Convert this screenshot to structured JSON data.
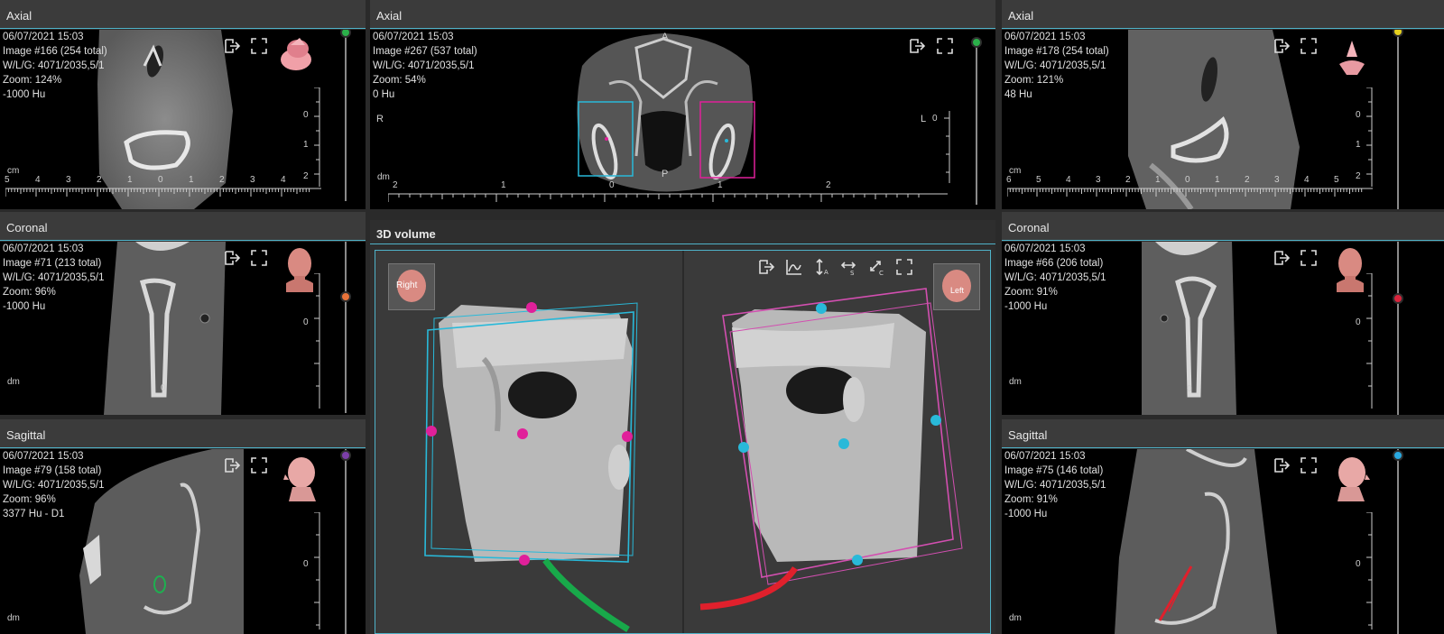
{
  "panels": {
    "axial_left": {
      "title": "Axial",
      "date": "06/07/2021 15:03",
      "image": "Image #166 (254 total)",
      "wl": "W/L/G: 4071/2035,5/1",
      "zoom": "Zoom: 124%",
      "hu": "-1000 Hu",
      "unit": "cm",
      "ticks": [
        "5",
        "4",
        "3",
        "2",
        "1",
        "0",
        "1",
        "2",
        "3",
        "4"
      ],
      "vticks": [
        "0",
        "1",
        "2"
      ],
      "knob_color": "#2bb04a"
    },
    "axial_center": {
      "title": "Axial",
      "date": "06/07/2021 15:03",
      "image": "Image #267 (537 total)",
      "wl": "W/L/G: 4071/2035,5/1",
      "zoom": "Zoom: 54%",
      "hu": "0 Hu",
      "unit": "dm",
      "ticks": [
        "2",
        "1",
        "0",
        "1",
        "2"
      ],
      "label_r": "R",
      "label_l": "L",
      "label_a": "A",
      "label_p": "P",
      "vticks": [
        "0"
      ],
      "knob_color": "#2bb04a"
    },
    "axial_right": {
      "title": "Axial",
      "date": "06/07/2021 15:03",
      "image": "Image #178 (254 total)",
      "wl": "W/L/G: 4071/2035,5/1",
      "zoom": "Zoom: 121%",
      "hu": "48 Hu",
      "unit": "cm",
      "ticks": [
        "6",
        "5",
        "4",
        "3",
        "2",
        "1",
        "0",
        "1",
        "2",
        "3",
        "4",
        "5"
      ],
      "vticks": [
        "0",
        "1",
        "2"
      ],
      "knob_color": "#e6d21e"
    },
    "coronal_left": {
      "title": "Coronal",
      "date": "06/07/2021 15:03",
      "image": "Image #71 (213 total)",
      "wl": "W/L/G: 4071/2035,5/1",
      "zoom": "Zoom: 96%",
      "hu": "-1000 Hu",
      "unit": "dm",
      "vticks": [
        "0",
        "0"
      ],
      "knob_color": "#e8733a"
    },
    "coronal_right": {
      "title": "Coronal",
      "date": "06/07/2021 15:03",
      "image": "Image #66 (206 total)",
      "wl": "W/L/G: 4071/2035,5/1",
      "zoom": "Zoom: 91%",
      "hu": "-1000 Hu",
      "unit": "dm",
      "vticks": [
        "0",
        "0"
      ],
      "knob_color": "#d9243c"
    },
    "sagittal_left": {
      "title": "Sagittal",
      "date": "06/07/2021 15:03",
      "image": "Image #79 (158 total)",
      "wl": "W/L/G: 4071/2035,5/1",
      "zoom": "Zoom: 96%",
      "hu": "3377 Hu - D1",
      "unit": "dm",
      "vticks": [
        "0"
      ],
      "knob_color": "#7b3fa8"
    },
    "sagittal_right": {
      "title": "Sagittal",
      "date": "06/07/2021 15:03",
      "image": "Image #75 (146 total)",
      "wl": "W/L/G: 4071/2035,5/1",
      "zoom": "Zoom: 91%",
      "hu": "-1000 Hu",
      "unit": "dm",
      "vticks": [
        "0"
      ],
      "knob_color": "#29a9e0"
    },
    "volume": {
      "title": "3D volume",
      "cube_right": "Right",
      "cube_left": "Left"
    }
  },
  "colors": {
    "accent": "#4fb3c9",
    "magenta": "#e0209a",
    "cyan": "#29b9d9",
    "green": "#18a94a",
    "red": "#e0202c",
    "panel_bg": "#2e2e2e",
    "header_bg": "#3b3b3b"
  },
  "icons": [
    "export-icon",
    "fullscreen-icon",
    "histogram-icon",
    "axial-arrow-icon",
    "sagittal-arrow-icon",
    "coronal-arrow-icon"
  ]
}
